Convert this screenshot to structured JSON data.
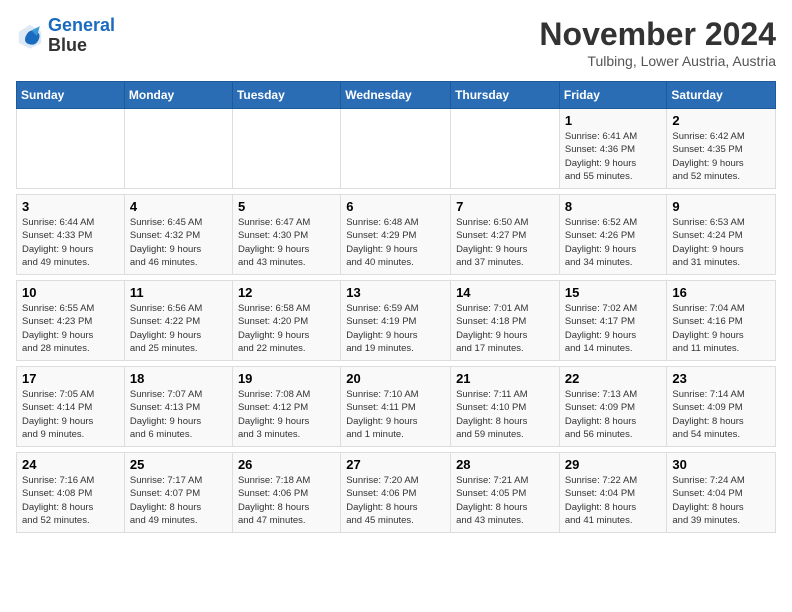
{
  "header": {
    "logo_line1": "General",
    "logo_line2": "Blue",
    "month": "November 2024",
    "location": "Tulbing, Lower Austria, Austria"
  },
  "weekdays": [
    "Sunday",
    "Monday",
    "Tuesday",
    "Wednesday",
    "Thursday",
    "Friday",
    "Saturday"
  ],
  "weeks": [
    [
      {
        "day": "",
        "info": ""
      },
      {
        "day": "",
        "info": ""
      },
      {
        "day": "",
        "info": ""
      },
      {
        "day": "",
        "info": ""
      },
      {
        "day": "",
        "info": ""
      },
      {
        "day": "1",
        "info": "Sunrise: 6:41 AM\nSunset: 4:36 PM\nDaylight: 9 hours\nand 55 minutes."
      },
      {
        "day": "2",
        "info": "Sunrise: 6:42 AM\nSunset: 4:35 PM\nDaylight: 9 hours\nand 52 minutes."
      }
    ],
    [
      {
        "day": "3",
        "info": "Sunrise: 6:44 AM\nSunset: 4:33 PM\nDaylight: 9 hours\nand 49 minutes."
      },
      {
        "day": "4",
        "info": "Sunrise: 6:45 AM\nSunset: 4:32 PM\nDaylight: 9 hours\nand 46 minutes."
      },
      {
        "day": "5",
        "info": "Sunrise: 6:47 AM\nSunset: 4:30 PM\nDaylight: 9 hours\nand 43 minutes."
      },
      {
        "day": "6",
        "info": "Sunrise: 6:48 AM\nSunset: 4:29 PM\nDaylight: 9 hours\nand 40 minutes."
      },
      {
        "day": "7",
        "info": "Sunrise: 6:50 AM\nSunset: 4:27 PM\nDaylight: 9 hours\nand 37 minutes."
      },
      {
        "day": "8",
        "info": "Sunrise: 6:52 AM\nSunset: 4:26 PM\nDaylight: 9 hours\nand 34 minutes."
      },
      {
        "day": "9",
        "info": "Sunrise: 6:53 AM\nSunset: 4:24 PM\nDaylight: 9 hours\nand 31 minutes."
      }
    ],
    [
      {
        "day": "10",
        "info": "Sunrise: 6:55 AM\nSunset: 4:23 PM\nDaylight: 9 hours\nand 28 minutes."
      },
      {
        "day": "11",
        "info": "Sunrise: 6:56 AM\nSunset: 4:22 PM\nDaylight: 9 hours\nand 25 minutes."
      },
      {
        "day": "12",
        "info": "Sunrise: 6:58 AM\nSunset: 4:20 PM\nDaylight: 9 hours\nand 22 minutes."
      },
      {
        "day": "13",
        "info": "Sunrise: 6:59 AM\nSunset: 4:19 PM\nDaylight: 9 hours\nand 19 minutes."
      },
      {
        "day": "14",
        "info": "Sunrise: 7:01 AM\nSunset: 4:18 PM\nDaylight: 9 hours\nand 17 minutes."
      },
      {
        "day": "15",
        "info": "Sunrise: 7:02 AM\nSunset: 4:17 PM\nDaylight: 9 hours\nand 14 minutes."
      },
      {
        "day": "16",
        "info": "Sunrise: 7:04 AM\nSunset: 4:16 PM\nDaylight: 9 hours\nand 11 minutes."
      }
    ],
    [
      {
        "day": "17",
        "info": "Sunrise: 7:05 AM\nSunset: 4:14 PM\nDaylight: 9 hours\nand 9 minutes."
      },
      {
        "day": "18",
        "info": "Sunrise: 7:07 AM\nSunset: 4:13 PM\nDaylight: 9 hours\nand 6 minutes."
      },
      {
        "day": "19",
        "info": "Sunrise: 7:08 AM\nSunset: 4:12 PM\nDaylight: 9 hours\nand 3 minutes."
      },
      {
        "day": "20",
        "info": "Sunrise: 7:10 AM\nSunset: 4:11 PM\nDaylight: 9 hours\nand 1 minute."
      },
      {
        "day": "21",
        "info": "Sunrise: 7:11 AM\nSunset: 4:10 PM\nDaylight: 8 hours\nand 59 minutes."
      },
      {
        "day": "22",
        "info": "Sunrise: 7:13 AM\nSunset: 4:09 PM\nDaylight: 8 hours\nand 56 minutes."
      },
      {
        "day": "23",
        "info": "Sunrise: 7:14 AM\nSunset: 4:09 PM\nDaylight: 8 hours\nand 54 minutes."
      }
    ],
    [
      {
        "day": "24",
        "info": "Sunrise: 7:16 AM\nSunset: 4:08 PM\nDaylight: 8 hours\nand 52 minutes."
      },
      {
        "day": "25",
        "info": "Sunrise: 7:17 AM\nSunset: 4:07 PM\nDaylight: 8 hours\nand 49 minutes."
      },
      {
        "day": "26",
        "info": "Sunrise: 7:18 AM\nSunset: 4:06 PM\nDaylight: 8 hours\nand 47 minutes."
      },
      {
        "day": "27",
        "info": "Sunrise: 7:20 AM\nSunset: 4:06 PM\nDaylight: 8 hours\nand 45 minutes."
      },
      {
        "day": "28",
        "info": "Sunrise: 7:21 AM\nSunset: 4:05 PM\nDaylight: 8 hours\nand 43 minutes."
      },
      {
        "day": "29",
        "info": "Sunrise: 7:22 AM\nSunset: 4:04 PM\nDaylight: 8 hours\nand 41 minutes."
      },
      {
        "day": "30",
        "info": "Sunrise: 7:24 AM\nSunset: 4:04 PM\nDaylight: 8 hours\nand 39 minutes."
      }
    ]
  ]
}
